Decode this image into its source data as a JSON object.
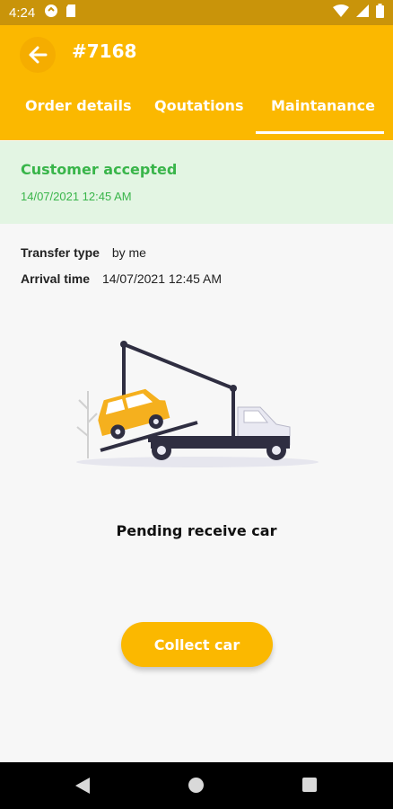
{
  "status_bar": {
    "time": "4:24",
    "icons": [
      "cloud-sync-icon",
      "sd-card-icon",
      "wifi-icon",
      "signal-icon",
      "battery-icon"
    ]
  },
  "header": {
    "back_icon": "arrow-left-icon",
    "order_number": "#7168"
  },
  "tabs": [
    {
      "label": "Order details"
    },
    {
      "label": "Qoutations"
    },
    {
      "label": "Maintanance",
      "selected": true
    }
  ],
  "status_banner": {
    "title": "Customer accepted",
    "date": "14/07/2021 12:45 AM",
    "color": "#39b54a"
  },
  "details": {
    "transfer_type_label": "Transfer type",
    "transfer_type_value": "by me",
    "arrival_time_label": "Arrival time",
    "arrival_time_value": "14/07/2021 12:45 AM"
  },
  "illustration": "tow-truck-illustration",
  "pending_text": "Pending receive car",
  "collect_button": "Collect car",
  "colors": {
    "accent": "#fbb800",
    "status_bar": "#c9940a",
    "banner_bg": "#e3f5e3"
  },
  "nav": {
    "back": "triangle-back-icon",
    "home": "circle-home-icon",
    "recent": "square-recent-icon"
  }
}
